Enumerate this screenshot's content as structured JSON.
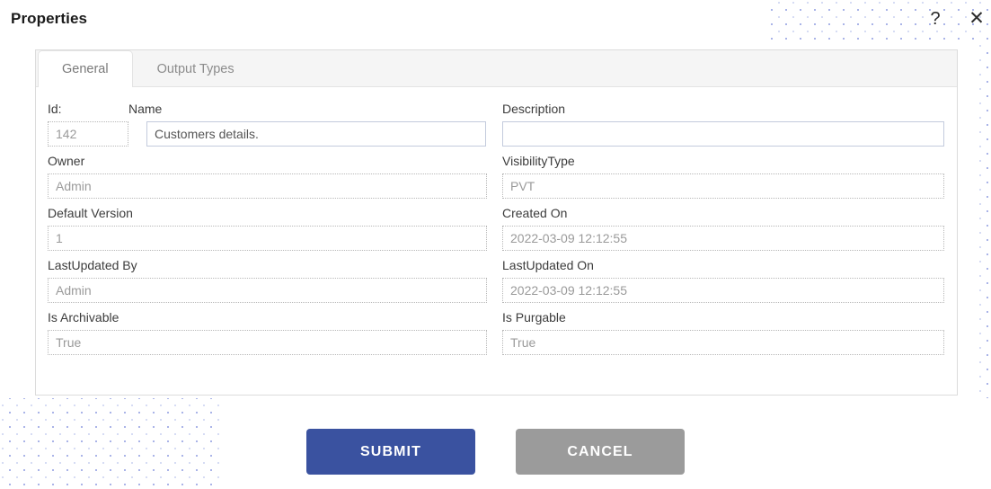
{
  "header": {
    "title": "Properties",
    "help_icon": "question-mark-icon",
    "close_icon": "close-icon",
    "help_glyph": "?",
    "close_glyph": "✕"
  },
  "tabs": [
    {
      "label": "General",
      "active": true
    },
    {
      "label": "Output Types",
      "active": false
    }
  ],
  "form": {
    "id": {
      "label": "Id:",
      "value": "142",
      "placeholder": "",
      "state": "disabled"
    },
    "name": {
      "label": "Name",
      "value": "Customers details.",
      "placeholder": "",
      "state": "editable"
    },
    "description": {
      "label": "Description",
      "value": "",
      "placeholder": "",
      "state": "editable"
    },
    "owner": {
      "label": "Owner",
      "value": "Admin",
      "placeholder": "",
      "state": "disabled"
    },
    "visibility_type": {
      "label": "VisibilityType",
      "value": "PVT",
      "placeholder": "",
      "state": "disabled"
    },
    "default_version": {
      "label": "Default Version",
      "value": "1",
      "placeholder": "",
      "state": "disabled"
    },
    "created_on": {
      "label": "Created On",
      "value": "2022-03-09 12:12:55",
      "placeholder": "",
      "state": "disabled"
    },
    "last_updated_by": {
      "label": "LastUpdated By",
      "value": "Admin",
      "placeholder": "",
      "state": "disabled"
    },
    "last_updated_on": {
      "label": "LastUpdated On",
      "value": "2022-03-09 12:12:55",
      "placeholder": "",
      "state": "disabled"
    },
    "is_archivable": {
      "label": "Is Archivable",
      "value": "True",
      "placeholder": "",
      "state": "disabled"
    },
    "is_purgable": {
      "label": "Is Purgable",
      "value": "True",
      "placeholder": "",
      "state": "disabled"
    }
  },
  "footer": {
    "submit_label": "SUBMIT",
    "cancel_label": "CANCEL"
  },
  "colors": {
    "submit": "#3a52a0",
    "cancel": "#9b9b9b",
    "tab_active_bg": "#ffffff",
    "tab_strip_bg": "#f5f5f5",
    "pattern_dot": "#aab4e8",
    "editable_border": "#c3cbdd",
    "disabled_border": "#b8b8b8"
  }
}
